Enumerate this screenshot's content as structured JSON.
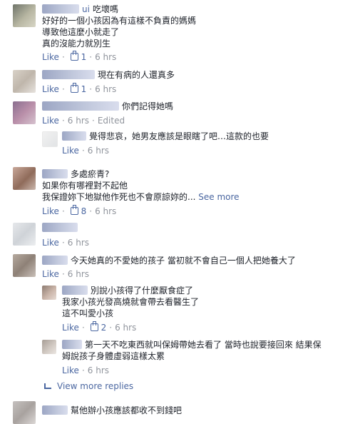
{
  "comments": [
    {
      "id": "c1",
      "name_suffix": "ui",
      "text_inline": "吃壞嗎",
      "text_lines": [
        "好好的一個小孩因為有這樣不負責的媽媽",
        "導致他這麼小就走了",
        "真的沒能力就別生"
      ],
      "like_label": "Like",
      "likes": "1",
      "time": "6 hrs"
    },
    {
      "id": "c2",
      "text_inline": "現在有病的人還真多",
      "like_label": "Like",
      "likes": "1",
      "time": "6 hrs"
    },
    {
      "id": "c3",
      "text_inline": "你們記得她嗎",
      "like_label": "Like",
      "time": "6 hrs",
      "edited": "Edited"
    },
    {
      "id": "c3r1",
      "text_inline": "覺得悲哀，她男友應該是眼瞎了吧…這款的也要",
      "like_label": "Like",
      "time": "6 hrs"
    },
    {
      "id": "c4",
      "text_inline": "多處瘀青?",
      "text_lines": [
        "如果你有哪裡對不起他",
        "我保證妳下地獄他作死也不會原諒妳的..."
      ],
      "see_more": "See more",
      "like_label": "Like",
      "likes": "8",
      "time": "6 hrs"
    },
    {
      "id": "c5",
      "like_label": "Like",
      "time": "6 hrs"
    },
    {
      "id": "c6",
      "text_inline": "今天她真的不愛她的孩子 當初就不會自己一個人把她養大了",
      "like_label": "Like",
      "time": "6 hrs"
    },
    {
      "id": "c6r1",
      "text_inline": "別說小孩得了什麼厭食症了",
      "text_lines": [
        "我家小孩光發高燒就會帶去看醫生了",
        "這不叫愛小孩"
      ],
      "like_label": "Like",
      "likes": "2",
      "time": "6 hrs"
    },
    {
      "id": "c6r2",
      "text_inline": "第一天不吃東西就叫保姆帶她去看了 當時也說要接回來 結果保",
      "text_lines": [
        "姆說孩子身體虛弱這樣太累"
      ],
      "like_label": "Like",
      "time": "6 hrs"
    },
    {
      "id": "c7",
      "text_inline": "幫他辦小孩應該都收不到錢吧"
    }
  ],
  "view_more": "View more replies",
  "separator": "·",
  "colors": {
    "link": "#4b67a1",
    "meta": "#90949c",
    "text": "#1d2129"
  }
}
